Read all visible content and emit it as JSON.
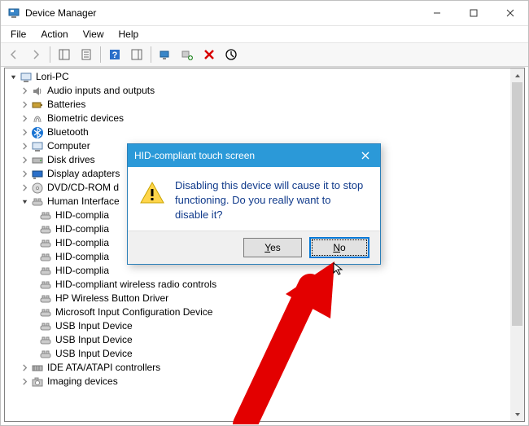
{
  "window": {
    "title": "Device Manager"
  },
  "menu": {
    "file": "File",
    "action": "Action",
    "view": "View",
    "help": "Help"
  },
  "tree": {
    "root": "Lori-PC",
    "cats": [
      "Audio inputs and outputs",
      "Batteries",
      "Biometric devices",
      "Bluetooth",
      "Computer",
      "Disk drives",
      "Display adapters",
      "DVD/CD-ROM d",
      "Human Interface",
      "IDE ATA/ATAPI controllers",
      "Imaging devices"
    ],
    "hid": [
      "HID-complia",
      "HID-complia",
      "HID-complia",
      "HID-complia",
      "HID-complia",
      "HID-compliant wireless radio controls",
      "HP Wireless Button Driver",
      "Microsoft Input Configuration Device",
      "USB Input Device",
      "USB Input Device",
      "USB Input Device"
    ]
  },
  "dialog": {
    "title": "HID-compliant touch screen",
    "message": "Disabling this device will cause it to stop functioning. Do you really want to disable it?",
    "yes": "Yes",
    "no": "No",
    "yes_hotkey": "Y",
    "no_hotkey": "N"
  }
}
